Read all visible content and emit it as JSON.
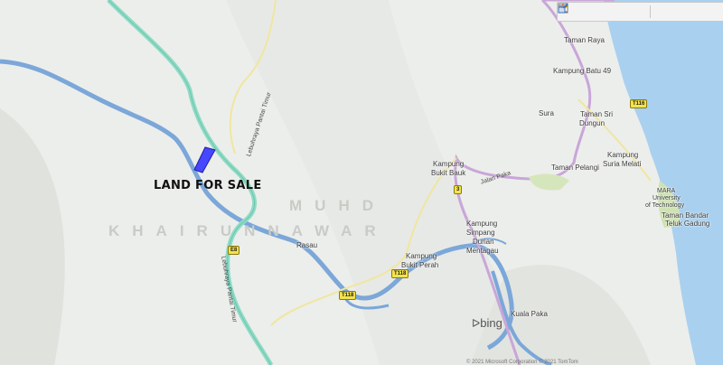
{
  "map": {
    "places": [
      {
        "name": "Taman Raya"
      },
      {
        "name": "Kampung Batu 49"
      },
      {
        "name": "Sura"
      },
      {
        "name": "Taman Sri"
      },
      {
        "name": "Dungun"
      },
      {
        "name": "Kampung"
      },
      {
        "name": "Suria Melati"
      },
      {
        "name": "Taman Pelangi"
      },
      {
        "name": "Kampung"
      },
      {
        "name": "Bukit Bauk"
      },
      {
        "name": "MARA"
      },
      {
        "name": "University"
      },
      {
        "name": "of Technology"
      },
      {
        "name": "Taman Bandar"
      },
      {
        "name": "Teluk Gadung"
      },
      {
        "name": "Kampung"
      },
      {
        "name": "Simpang"
      },
      {
        "name": "Durian"
      },
      {
        "name": "Mentagau"
      },
      {
        "name": "Rasau"
      },
      {
        "name": "Kampung"
      },
      {
        "name": "Bukit Perah"
      },
      {
        "name": "Kuala Paka"
      }
    ],
    "roads": {
      "lebuhraya_top": "Lebuhraya Pantai Timur",
      "lebuhraya_bottom": "Lebuhraya Pantai Timur",
      "jalan_paka": "Jalan Paka"
    },
    "shields": {
      "t116": "T116",
      "r3": "3",
      "e8": "E8",
      "t118a": "T118",
      "t118b": "T118"
    },
    "watermark": {
      "line1": "MUHD",
      "line2": "KHAIRUNNAWAR"
    },
    "land_label": "LAND FOR SALE",
    "bing": "bing",
    "copyright": "© 2021 Microsoft Corporation © 2021 TomTom",
    "toolbar_icons": [
      "zoom-in-icon",
      "zoom-out-icon",
      "layers-icon",
      "grid-icon",
      "window-icon",
      "pencil-icon",
      "export-icon"
    ],
    "colors": {
      "sea": "#a9d0ef",
      "highway": "#8fdbc6",
      "river": "#7ba7d9",
      "main_road": "#c9a6d8",
      "parcel": "#4747ff"
    }
  }
}
